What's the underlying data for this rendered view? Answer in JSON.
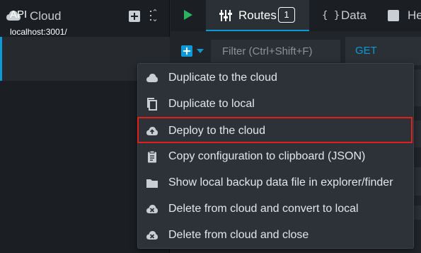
{
  "sidebar": {
    "title": "Cloud",
    "environment": {
      "name": "API",
      "url": "localhost:3001/"
    }
  },
  "tabs": {
    "routes_label": "Routes",
    "routes_count": "1",
    "data_label": "Data",
    "headers_label": "He"
  },
  "route_list": {
    "filter_placeholder": "Filter (Ctrl+Shift+F)"
  },
  "route_editor": {
    "method": "GET"
  },
  "context_menu": {
    "items": [
      {
        "label": "Duplicate to the cloud",
        "icon": "cloud-icon"
      },
      {
        "label": "Duplicate to local",
        "icon": "copy-icon"
      },
      {
        "label": "Deploy to the cloud",
        "icon": "cloud-upload-icon"
      },
      {
        "label": "Copy configuration to clipboard (JSON)",
        "icon": "clipboard-icon"
      },
      {
        "label": "Show local backup data file in explorer/finder",
        "icon": "folder-icon"
      },
      {
        "label": "Delete from cloud and convert to local",
        "icon": "cloud-delete-icon"
      },
      {
        "label": "Delete from cloud and close",
        "icon": "cloud-delete-icon"
      }
    ]
  },
  "colors": {
    "accent": "#0d99d6",
    "play": "#28b463",
    "highlight": "#e0201c"
  }
}
